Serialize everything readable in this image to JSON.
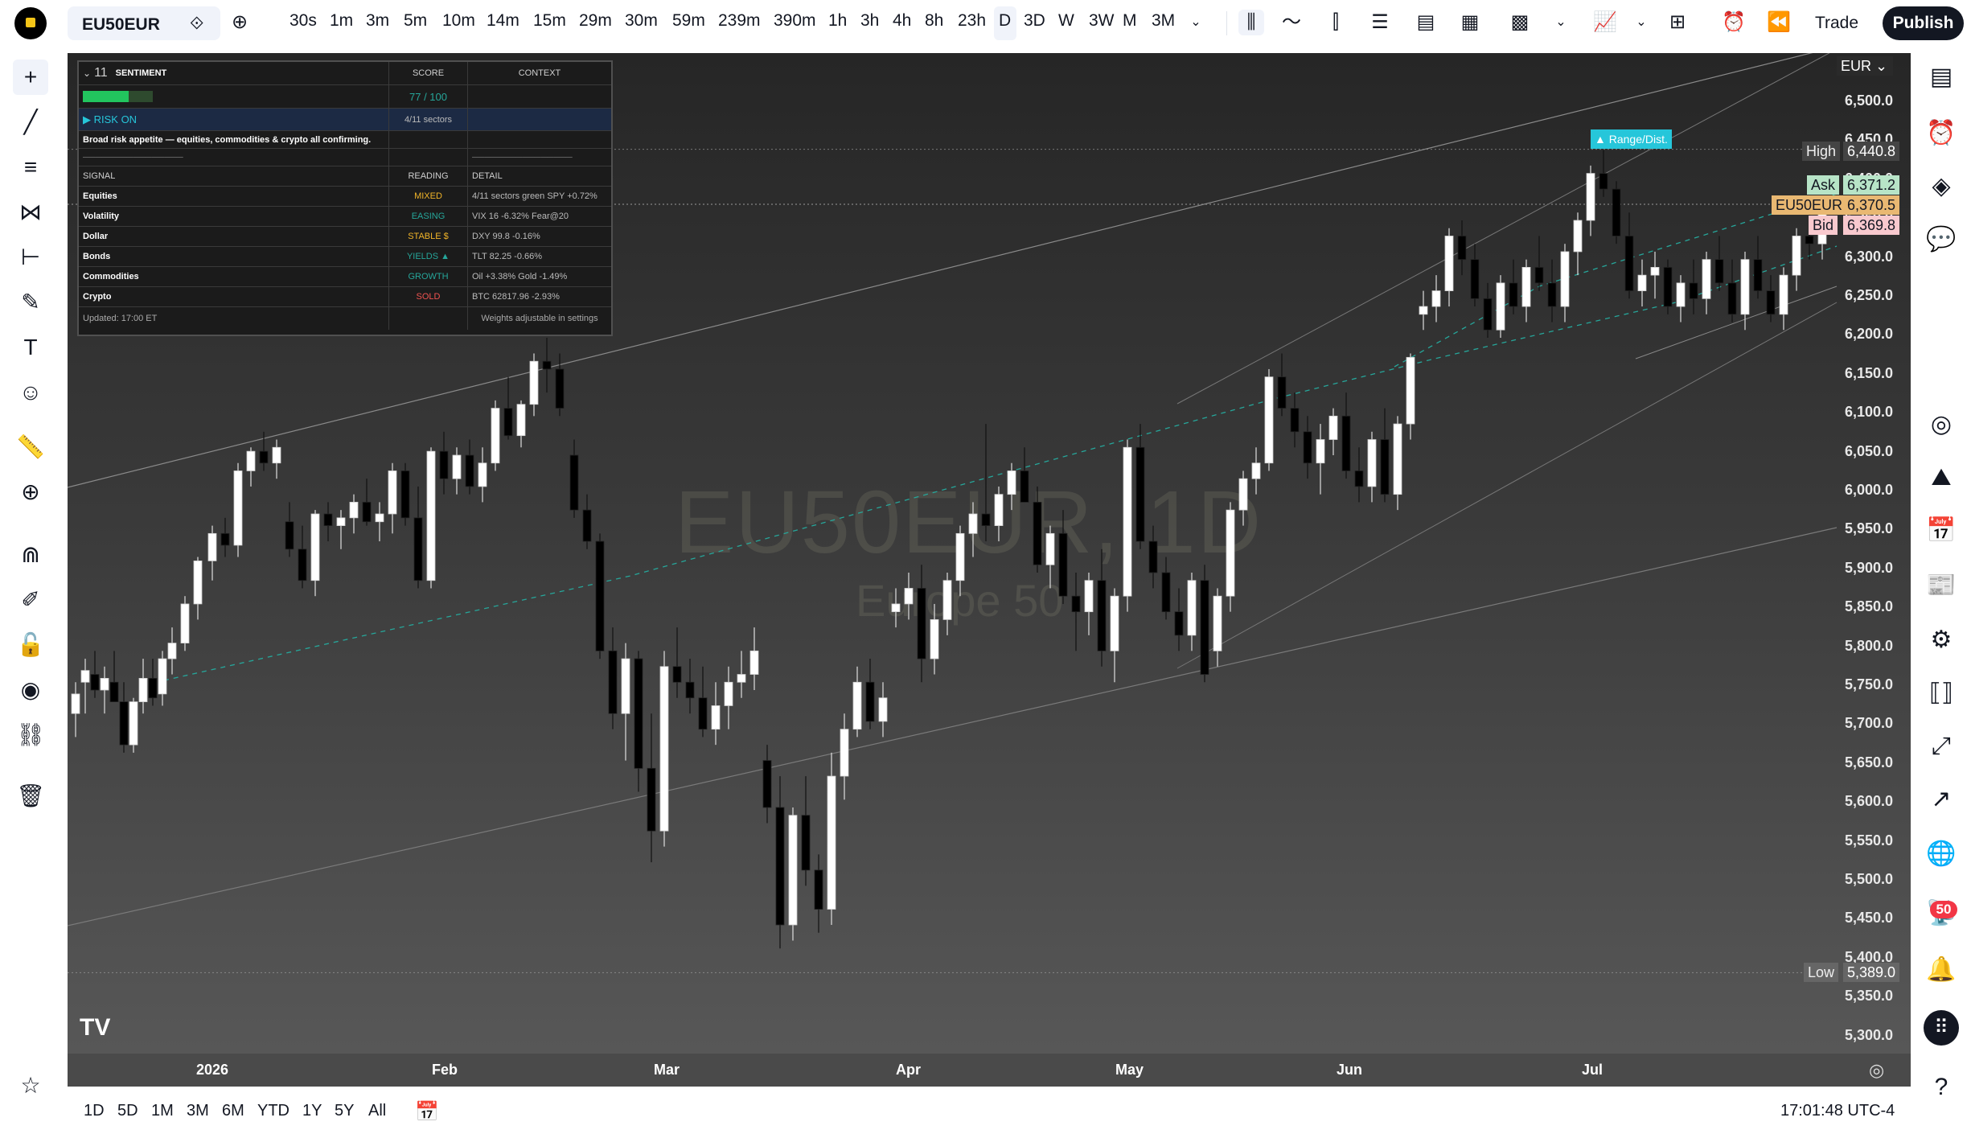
{
  "topbar": {
    "symbol": "EU50EUR",
    "intervals": [
      "30s",
      "1m",
      "3m",
      "5m",
      "10m",
      "14m",
      "15m",
      "29m",
      "30m",
      "59m",
      "239m",
      "390m",
      "1h",
      "3h",
      "4h",
      "8h",
      "23h",
      "D",
      "3D",
      "W",
      "3W",
      "M",
      "3M"
    ],
    "active_interval": "D",
    "trade_label": "Trade",
    "publish_label": "Publish"
  },
  "chart": {
    "watermark_symbol": "EU50EUR, 1D",
    "watermark_name": "Europe 50",
    "currency": "EUR",
    "price_ticks": [
      "6,500.0",
      "6,450.0",
      "6,400.0",
      "6,350.0",
      "6,300.0",
      "6,250.0",
      "6,200.0",
      "6,150.0",
      "6,100.0",
      "6,050.0",
      "6,000.0",
      "5,950.0",
      "5,900.0",
      "5,850.0",
      "5,800.0",
      "5,750.0",
      "5,700.0",
      "5,650.0",
      "5,600.0",
      "5,550.0",
      "5,500.0",
      "5,450.0",
      "5,400.0",
      "5,350.0",
      "5,300.0"
    ],
    "time_labels": [
      "2026",
      "Feb",
      "Mar",
      "Apr",
      "May",
      "Jun",
      "Jul"
    ],
    "high_label": "High",
    "high_value": "6,440.8",
    "ask_label": "Ask",
    "ask_value": "6,371.2",
    "last_label": "EU50EUR",
    "last_value": "6,370.5",
    "bid_label": "Bid",
    "bid_value": "6,369.8",
    "low_label": "Low",
    "low_value": "5,389.0",
    "annotation": "▲ Range/Dist.",
    "colors": {
      "up": "#ffffff",
      "down": "#000000",
      "ask": "#b7e4c7",
      "last": "#e9b872",
      "bid": "#f8c9ce",
      "annotation": "#26c6da"
    }
  },
  "sentiment": {
    "header_num": "11",
    "title": "SENTIMENT",
    "score_header": "SCORE",
    "context_header": "CONTEXT",
    "score": "77 / 100",
    "score_fraction": 0.77,
    "regime": "▶ RISK ON",
    "sectors": "4/11 sectors",
    "summary": "Broad risk appetite — equities, commodities & crypto all confirming.",
    "divider": "────────────────",
    "divider_short": "────────────────",
    "col_signal": "SIGNAL",
    "col_reading": "READING",
    "col_detail": "DETAIL",
    "rows": [
      {
        "signal": "Equities",
        "reading": "MIXED",
        "color": "#f0b429",
        "detail": "4/11 sectors green  SPY +0.72%"
      },
      {
        "signal": "Volatility",
        "reading": "EASING",
        "color": "#26a69a",
        "detail": "VIX 16  -6.32%  Fear@20"
      },
      {
        "signal": "Dollar",
        "reading": "STABLE $",
        "color": "#f0b429",
        "detail": "DXY 99.8  -0.16%"
      },
      {
        "signal": "Bonds",
        "reading": "YIELDS ▲",
        "color": "#26a69a",
        "detail": "TLT 82.25  -0.66%"
      },
      {
        "signal": "Commodities",
        "reading": "GROWTH",
        "color": "#26a69a",
        "detail": "Oil +3.38%  Gold -1.49%"
      },
      {
        "signal": "Crypto",
        "reading": "SOLD",
        "color": "#ef5350",
        "detail": "BTC 62817.96  -2.93%"
      }
    ],
    "updated": "Updated: 17:00 ET",
    "weights_note": "Weights adjustable in settings"
  },
  "bottombar": {
    "ranges": [
      "1D",
      "5D",
      "1M",
      "3M",
      "6M",
      "YTD",
      "1Y",
      "5Y",
      "All"
    ],
    "clock": "17:01:48 UTC-4"
  },
  "rightbar": {
    "notification_count": "50"
  }
}
